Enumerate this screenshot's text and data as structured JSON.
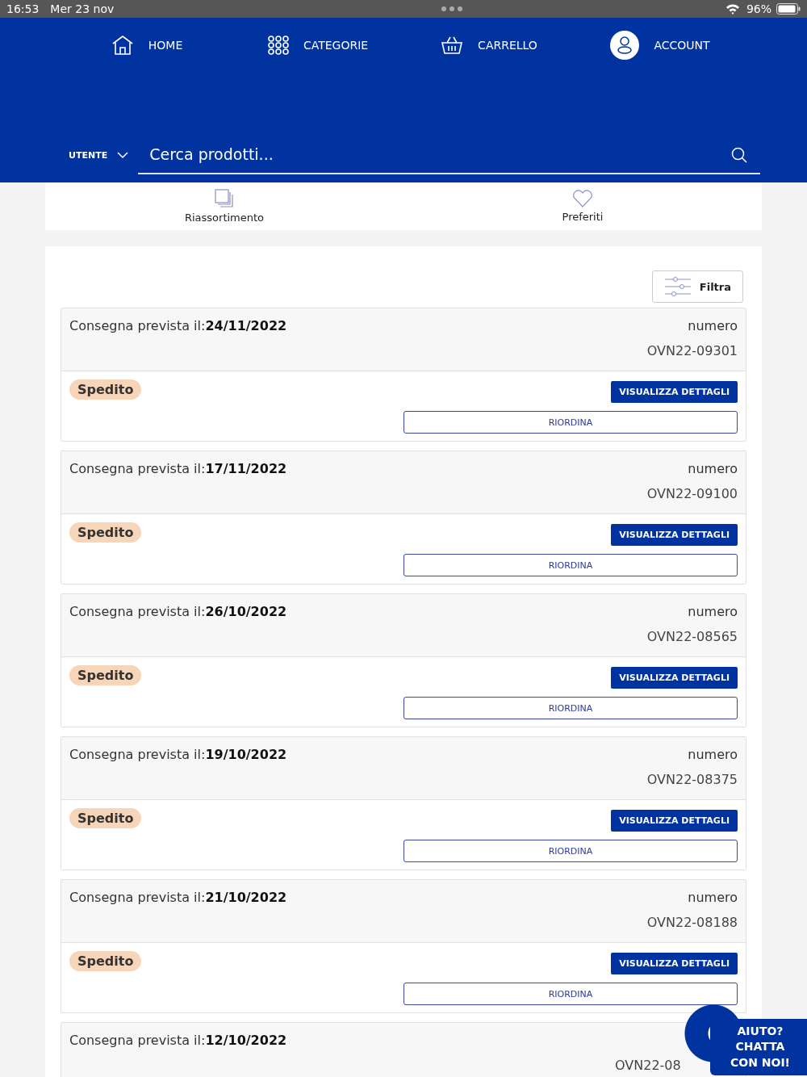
{
  "status_bar": {
    "time": "16:53",
    "date": "Mer 23 nov",
    "battery": "96%"
  },
  "nav": [
    {
      "label": "HOME",
      "kind": "home"
    },
    {
      "label": "CATEGORIE",
      "kind": "grid"
    },
    {
      "label": "CARRELLO",
      "kind": "basket"
    },
    {
      "label": "ACCOUNT",
      "kind": "account"
    }
  ],
  "search": {
    "scope": "UTENTE",
    "placeholder": "Cerca prodotti..."
  },
  "shortcuts": [
    {
      "label": "Riassortimento",
      "kind": "copies"
    },
    {
      "label": "Preferiti",
      "kind": "heart"
    }
  ],
  "filter_button": "Filtra",
  "orders": [
    {
      "delivery_label": "Consegna prevista il:",
      "date": "24/11/2022",
      "number_label": "numero",
      "number": "OVN22-09301",
      "status": "Spedito",
      "details_button": "VISUALIZZA DETTAGLI",
      "reorder_button": "RIORDINA"
    },
    {
      "delivery_label": "Consegna prevista il:",
      "date": "17/11/2022",
      "number_label": "numero",
      "number": "OVN22-09100",
      "status": "Spedito",
      "details_button": "VISUALIZZA DETTAGLI",
      "reorder_button": "RIORDINA"
    },
    {
      "delivery_label": "Consegna prevista il:",
      "date": "26/10/2022",
      "number_label": "numero",
      "number": "OVN22-08565",
      "status": "Spedito",
      "details_button": "VISUALIZZA DETTAGLI",
      "reorder_button": "RIORDINA"
    },
    {
      "delivery_label": "Consegna prevista il:",
      "date": "19/10/2022",
      "number_label": "numero",
      "number": "OVN22-08375",
      "status": "Spedito",
      "details_button": "VISUALIZZA DETTAGLI",
      "reorder_button": "RIORDINA"
    },
    {
      "delivery_label": "Consegna prevista il:",
      "date": "21/10/2022",
      "number_label": "numero",
      "number": "OVN22-08188",
      "status": "Spedito",
      "details_button": "VISUALIZZA DETTAGLI",
      "reorder_button": "RIORDINA"
    },
    {
      "delivery_label": "Consegna prevista il:",
      "date": "12/10/2022",
      "number": "OVN22-08"
    }
  ],
  "chat_widget": {
    "lines": [
      "AIUTO?",
      "CHATTA",
      "CON NOI!"
    ]
  }
}
